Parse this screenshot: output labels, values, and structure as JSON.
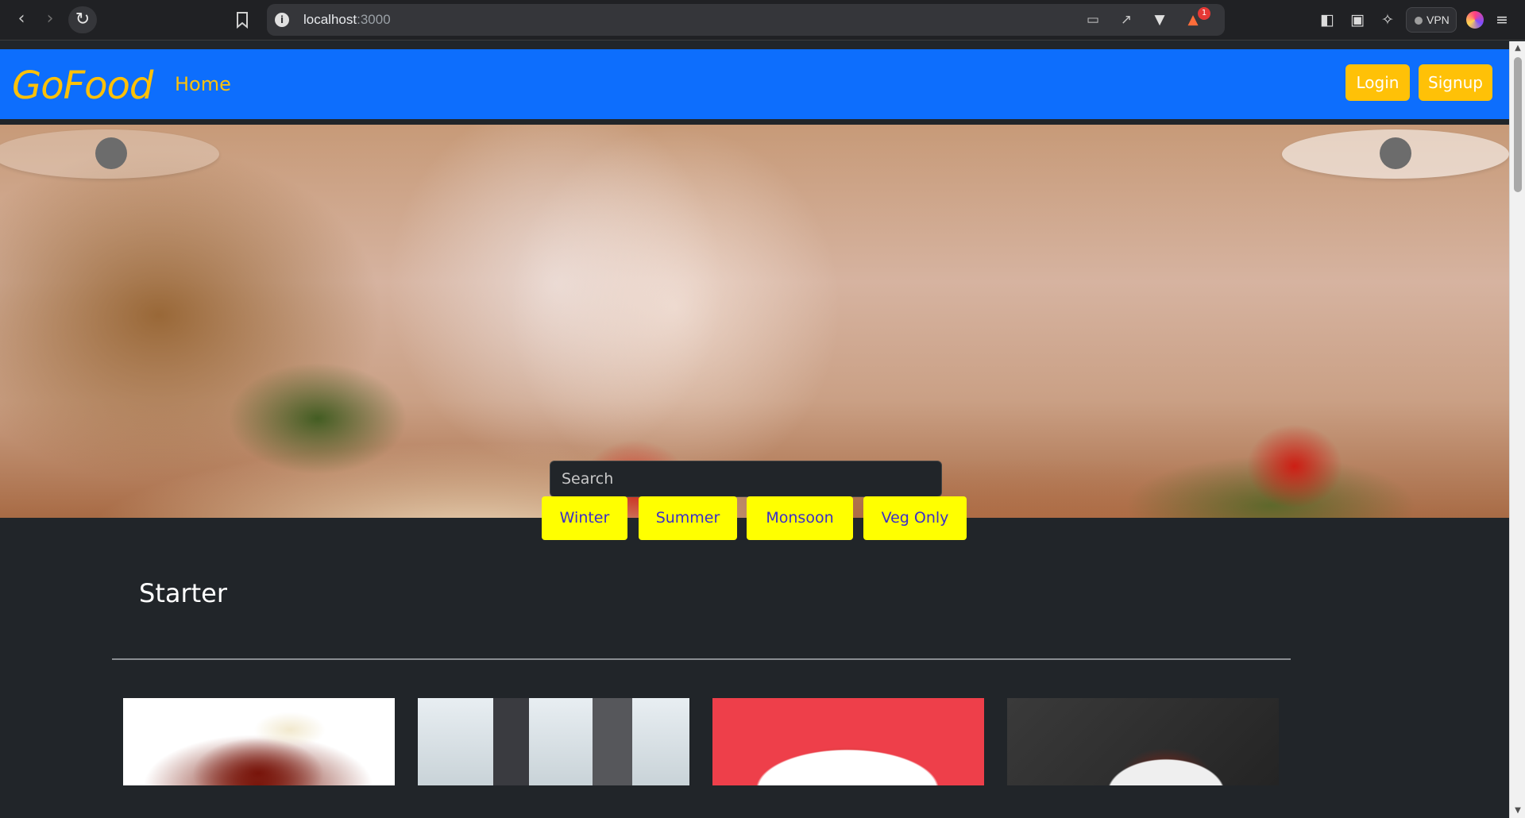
{
  "browser": {
    "url_host": "localhost",
    "url_port": ":3000",
    "badge_count": "1",
    "vpn_label": "VPN",
    "icons": {
      "back": "back-arrow-icon",
      "forward": "forward-arrow-icon",
      "reload": "reload-icon",
      "bookmark": "bookmark-icon",
      "site_info": "info-icon",
      "cast": "cast-icon",
      "share": "share-icon",
      "shield": "brave-shield-icon",
      "rewards": "brave-rewards-icon",
      "sidebar": "sidebar-icon",
      "wallet": "wallet-icon",
      "leo": "leo-ai-icon",
      "menu": "hamburger-menu-icon"
    }
  },
  "navbar": {
    "brand": "GoFood",
    "home": "Home",
    "login": "Login",
    "signup": "Signup"
  },
  "search": {
    "placeholder": "Search"
  },
  "filters": [
    "Winter",
    "Summer",
    "Monsoon",
    "Veg Only"
  ],
  "section": {
    "title": "Starter"
  },
  "colors": {
    "navbar_bg": "#0d6efd",
    "brand": "#ffc107",
    "page_bg": "#212529",
    "filter_bg": "#ffff00",
    "filter_text": "#3b2ec9"
  }
}
